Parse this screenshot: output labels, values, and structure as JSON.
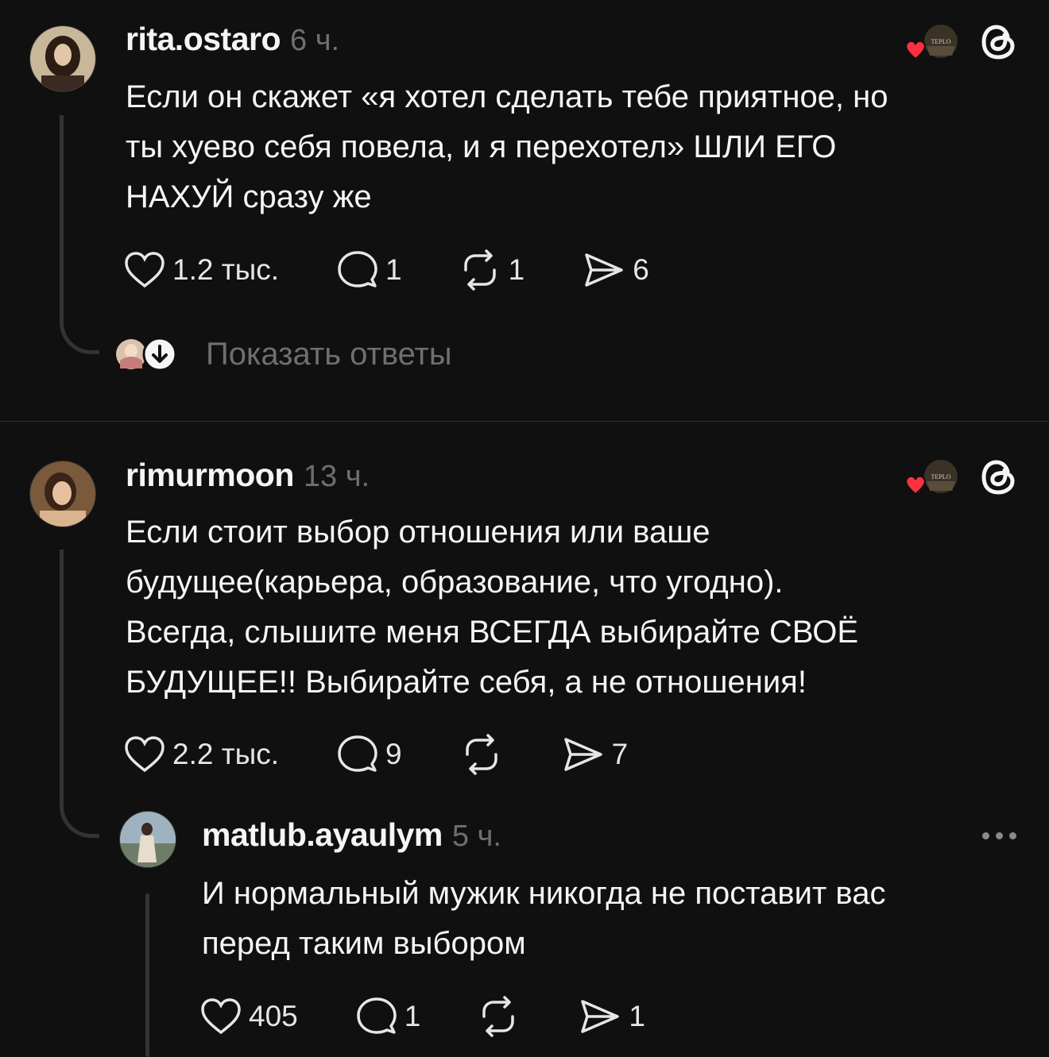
{
  "posts": [
    {
      "username": "rita.ostaro",
      "time": "6 ч.",
      "text": "Если он скажет «я хотел сделать тебе приятное, но\nты хуево себя повела, и я перехотел» ШЛИ ЕГО\nНАХУЙ сразу же",
      "likes": "1.2 тыс.",
      "comments": "1",
      "reposts": "1",
      "shares": "6",
      "liked_by_label": "TEPLO",
      "show_replies": "Показать ответы"
    },
    {
      "username": "rimurmoon",
      "time": "13 ч.",
      "text": "Если стоит выбор отношения или ваше\nбудущее(карьера, образование, что угодно).\nВсегда, слышите меня ВСЕГДА выбирайте СВОЁ\nБУДУЩЕЕ!! Выбирайте себя, а не отношения!",
      "likes": "2.2 тыс.",
      "comments": "9",
      "shares": "7",
      "liked_by_label": "TEPLO"
    }
  ],
  "reply": {
    "username": "matlub.ayaulym",
    "time": "5 ч.",
    "text": "И нормальный мужик никогда не поставит вас\nперед таким выбором",
    "likes": "405",
    "comments": "1",
    "shares": "1"
  },
  "colors": {
    "background": "#101010",
    "text": "#f3f5f7",
    "muted": "#6f6f6f",
    "heart": "#ff3040"
  },
  "icons": [
    "heart-icon",
    "comment-icon",
    "repost-icon",
    "share-icon",
    "threads-logo-icon",
    "more-icon",
    "arrow-down-icon"
  ]
}
